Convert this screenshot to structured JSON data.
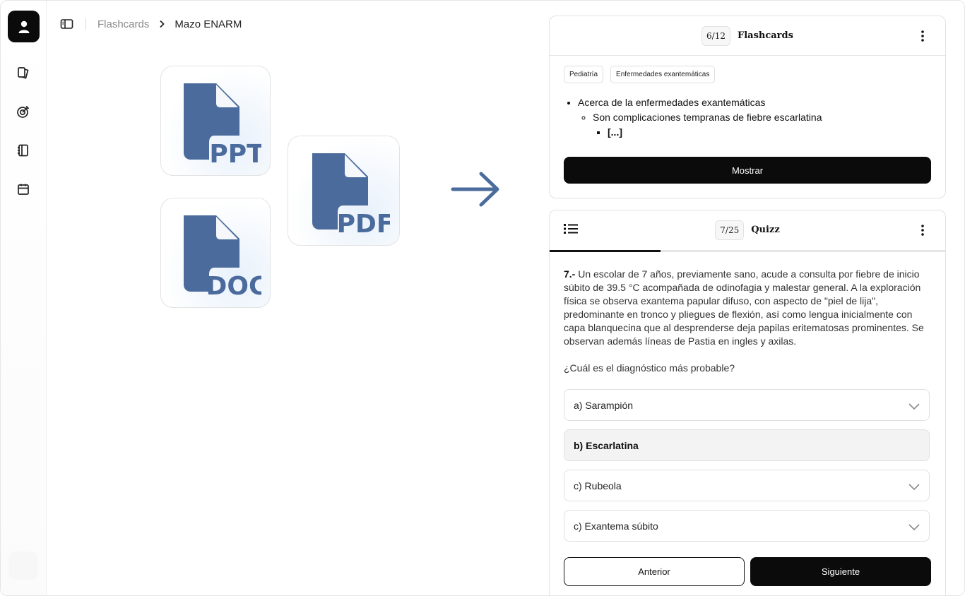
{
  "breadcrumb": {
    "items": [
      "Flashcards",
      "Mazo ENARM"
    ]
  },
  "sidebar": {
    "icons": [
      "user-icon",
      "cards-icon",
      "target-icon",
      "notebook-icon",
      "calendar-icon"
    ]
  },
  "files": [
    {
      "label": "PPT"
    },
    {
      "label": "PDF"
    },
    {
      "label": "DOC"
    }
  ],
  "flashcards": {
    "counter": "6/12",
    "title": "Flashcards",
    "tags": [
      "Pediatría",
      "Enfermedades exantemáticas"
    ],
    "bullets": {
      "level1": "Acerca de la enfermedades exantemáticas",
      "level2": "Son complicaciones tempranas de fiebre escarlatina",
      "level3": "[...]"
    },
    "show_button": "Mostrar"
  },
  "quiz": {
    "counter": "7/25",
    "title": "Quizz",
    "progress": 0.28,
    "question_number": "7.-",
    "question_text": " Un escolar de 7 años, previamente sano, acude a consulta por fiebre de inicio súbito de 39.5 °C acompañada de odinofagia y malestar general. A la exploración física se observa exantema papular difuso, con aspecto de \"piel de lija\", predominante en tronco y pliegues de flexión, así como lengua inicialmente con capa blanquecina que al desprenderse deja papilas eritematosas prominentes. Se observan además líneas de Pastia en ingles y axilas.",
    "prompt": "¿Cuál es el diagnóstico más probable?",
    "options": [
      {
        "label": "a) Sarampión",
        "selected": false
      },
      {
        "label": "b) Escarlatina",
        "selected": true
      },
      {
        "label": "c) Rubeola",
        "selected": false
      },
      {
        "label": "c) Exantema súbito",
        "selected": false
      }
    ],
    "prev_button": "Anterior",
    "next_button": "Siguiente"
  },
  "colors": {
    "file_icon": "#4a6b9c",
    "dark": "#0b0b0b",
    "accent_arrow": "#4a6b9c"
  }
}
